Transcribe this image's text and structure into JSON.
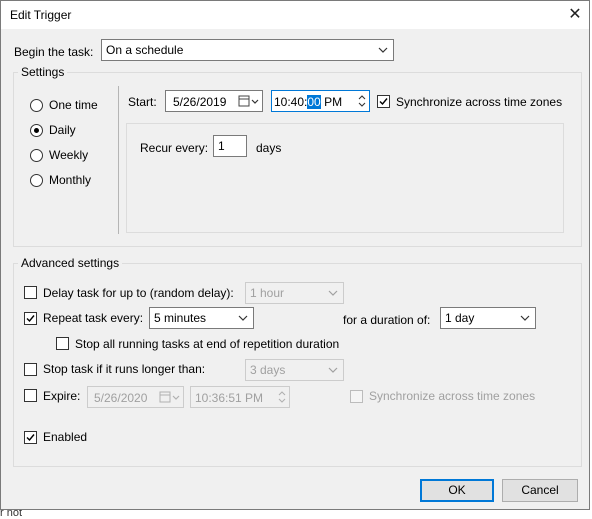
{
  "window": {
    "title": "Edit Trigger",
    "close_glyph": "✕"
  },
  "begin_task": {
    "label": "Begin the task:",
    "value": "On a schedule"
  },
  "settings": {
    "title": "Settings",
    "schedule_options": [
      "One time",
      "Daily",
      "Weekly",
      "Monthly"
    ],
    "selected_option": "Daily",
    "start_label": "Start:",
    "start_date": "5/26/2019",
    "start_time_prefix": "10:40:",
    "start_time_selected": "00",
    "start_time_suffix": " PM",
    "sync_label": "Synchronize across time zones",
    "sync_checked": true,
    "recur_label": "Recur every:",
    "recur_value": "1",
    "recur_unit": "days"
  },
  "advanced": {
    "title": "Advanced settings",
    "delay_label": "Delay task for up to (random delay):",
    "delay_checked": false,
    "delay_value": "1 hour",
    "repeat_label": "Repeat task every:",
    "repeat_checked": true,
    "repeat_value": "5 minutes",
    "duration_label": "for a duration of:",
    "duration_value": "1 day",
    "stop_running_label": "Stop all running tasks at end of repetition duration",
    "stop_running_checked": false,
    "stop_if_label": "Stop task if it runs longer than:",
    "stop_if_checked": false,
    "stop_if_value": "3 days",
    "expire_label": "Expire:",
    "expire_checked": false,
    "expire_date": "5/26/2020",
    "expire_time": "10:36:51 PM",
    "expire_sync_label": "Synchronize across time zones",
    "enabled_label": "Enabled",
    "enabled_checked": true
  },
  "buttons": {
    "ok": "OK",
    "cancel": "Cancel"
  },
  "background_text": "r not"
}
